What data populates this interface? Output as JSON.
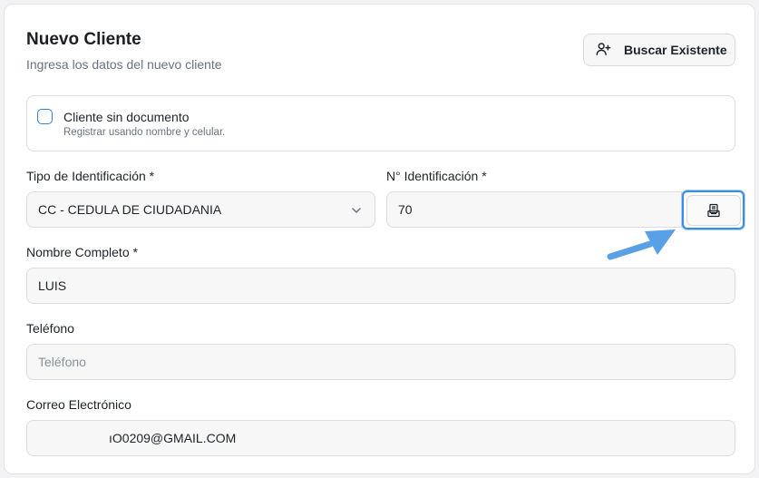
{
  "header": {
    "title": "Nuevo Cliente",
    "subtitle": "Ingresa los datos del nuevo cliente",
    "search_button_label": "Buscar Existente"
  },
  "no_document": {
    "label": "Cliente sin documento",
    "hint": "Registrar usando nombre y celular.",
    "checked": false
  },
  "form": {
    "id_type": {
      "label": "Tipo de Identificación *",
      "value": "CC - CEDULA DE CIUDADANIA"
    },
    "id_number": {
      "label": "N° Identificación *",
      "value": "70"
    },
    "full_name": {
      "label": "Nombre Completo *",
      "value": "LUIS"
    },
    "phone": {
      "label": "Teléfono",
      "placeholder": "Teléfono",
      "value": ""
    },
    "email": {
      "label": "Correo Electrónico",
      "value": "ıO0209@GMAIL.COM"
    }
  },
  "icons": {
    "search_button": "user-plus-icon",
    "doc_button": "document-lookup-icon",
    "id_type_select": "chevron-down-icon",
    "annotation": "arrow-pointer"
  },
  "colors": {
    "accent": "#3b8de0",
    "checkbox_border": "#2f7fd6",
    "annotation_arrow": "#5aa0e6"
  }
}
